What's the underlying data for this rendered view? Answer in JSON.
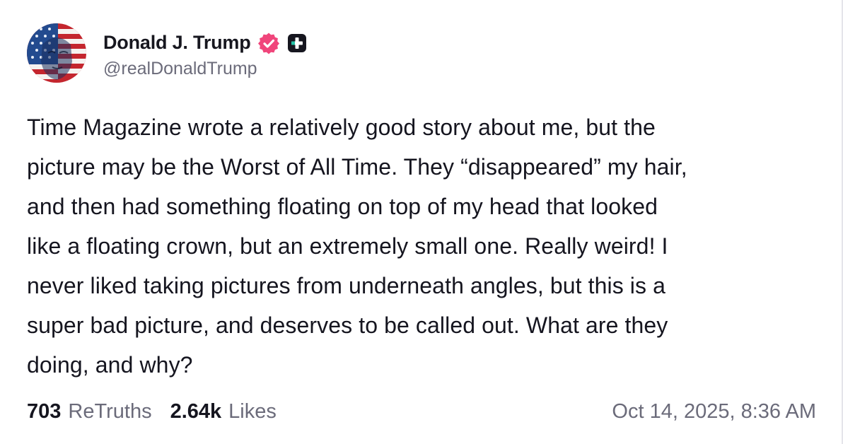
{
  "author": {
    "display_name": "Donald J. Trump",
    "handle": "@realDonaldTrump",
    "avatar_icon": "avatar-flag-portrait",
    "verified_icon": "verified-badge-icon",
    "verified_color": "#f0457b",
    "plus_icon": "truth-plus-icon"
  },
  "post": {
    "text": "Time Magazine wrote a relatively good story about me, but the\npicture may be the Worst of All Time. They “disappeared” my hair,\nand then had something floating on top of my head that looked\nlike a floating crown, but an extremely small one. Really weird! I\nnever liked taking pictures from underneath angles, but this is a\nsuper bad picture, and deserves to be called out. What are they\ndoing, and why?"
  },
  "stats": {
    "retruths_count": "703",
    "retruths_label": "ReTruths",
    "likes_count": "2.64k",
    "likes_label": "Likes"
  },
  "timestamp": "Oct 14, 2025, 8:36 AM",
  "colors": {
    "text": "#15151f",
    "muted": "#6b6b7a",
    "background": "#ffffff"
  }
}
